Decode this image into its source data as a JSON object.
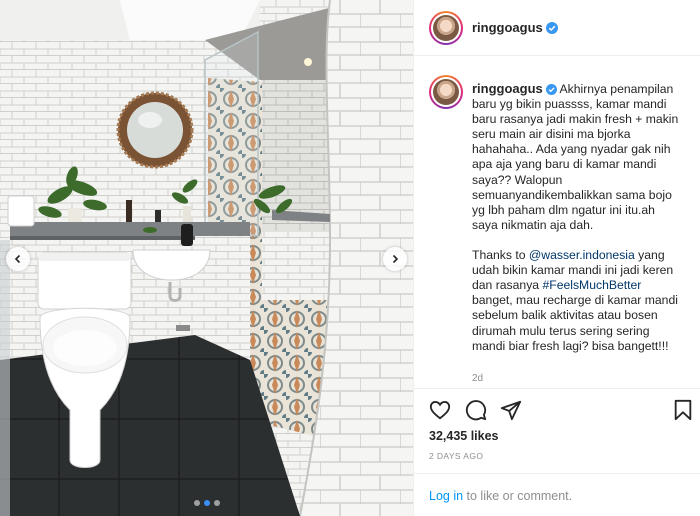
{
  "post": {
    "username": "ringgoagus",
    "caption": "Akhirnya penampilan baru yg bikin puassss, kamar mandi baru rasanya jadi makin fresh + makin seru main air disini ma bjorka hahahaha.. Ada yang nyadar gak nih apa aja yang baru di kamar mandi saya?? Walopun semuanyandikembalikkan sama bojo yg lbh paham dlm ngatur ini itu.ah saya nikmatin aja dah.",
    "caption2_pre": "Thanks to ",
    "mention": "@wasser.indonesia",
    "caption2_mid": " yang udah bikin kamar mandi ini jadi keren dan rasanya ",
    "hashtag": "#FeelsMuchBetter",
    "caption2_post": " banget, mau recharge di kamar mandi sebelum balik aktivitas atau bosen dirumah mulu terus sering sering mandi biar fresh lagi? bisa bangett!!!",
    "time_ago": "2d",
    "likes": "32,435 likes",
    "date": "2 DAYS AGO"
  },
  "login": {
    "link": "Log in",
    "rest": " to like or comment."
  },
  "carousel": {
    "slide_count": 3,
    "active_slide": 2
  },
  "icons": {
    "verified": "verified-badge-icon",
    "like": "heart-icon",
    "comment": "comment-icon",
    "share": "paper-plane-icon",
    "save": "bookmark-icon",
    "prev": "chevron-left-icon",
    "next": "chevron-right-icon"
  },
  "colors": {
    "verified": "#3897f0",
    "link": "#0095f6",
    "hashtag": "#00376b",
    "muted": "#8e8e8e",
    "dot_active": "#3b8ff3"
  }
}
